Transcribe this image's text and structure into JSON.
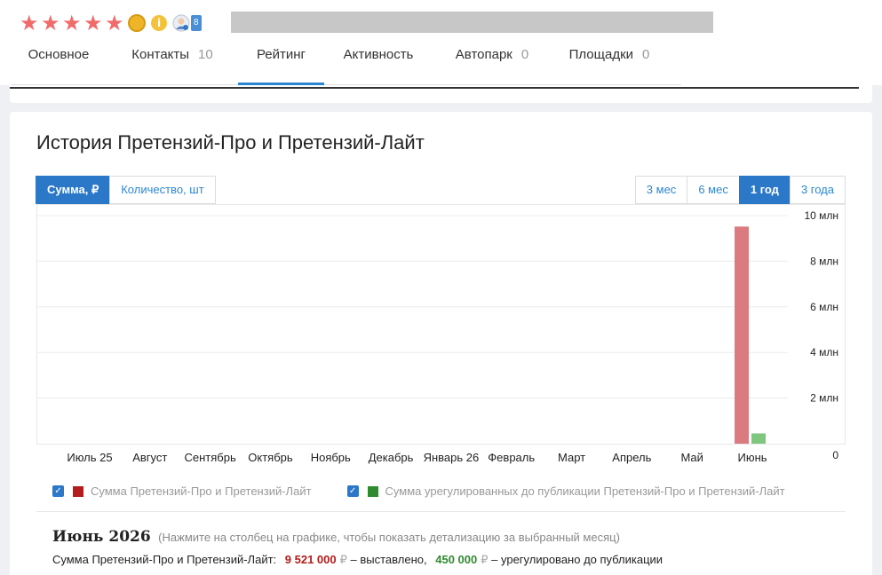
{
  "header": {
    "rating_stars": 5,
    "verified_count": "8",
    "info_badge": "i",
    "tabs": [
      {
        "label": "Основное",
        "count": ""
      },
      {
        "label": "Контакты",
        "count": "10"
      },
      {
        "label": "Рейтинг",
        "count": ""
      },
      {
        "label": "Активность",
        "count": ""
      },
      {
        "label": "Автопарк",
        "count": "0"
      },
      {
        "label": "Площадки",
        "count": "0"
      }
    ],
    "active_tab": "Рейтинг"
  },
  "card": {
    "title": "История Претензий-Про и Претензий-Лайт",
    "metric_buttons": [
      "Сумма, ₽",
      "Количество, шт"
    ],
    "active_metric": "Сумма, ₽",
    "period_buttons": [
      "3 мес",
      "6 мес",
      "1 год",
      "3 года"
    ],
    "active_period": "1 год"
  },
  "colors": {
    "accent": "#2b78c8",
    "star": "#f26b6b",
    "series_claims": "#db7b80",
    "series_settled": "#7fc67f",
    "legend_claims": "#b31d1d",
    "legend_settled": "#2e8b2e"
  },
  "chart_data": {
    "type": "bar",
    "categories": [
      "Июль 25",
      "Август",
      "Сентябрь",
      "Октябрь",
      "Ноябрь",
      "Декабрь",
      "Январь 26",
      "Февраль",
      "Март",
      "Апрель",
      "Май",
      "Июнь"
    ],
    "series": [
      {
        "name": "Сумма Претензий-Про и Претензий-Лайт",
        "values": [
          0,
          0,
          0,
          0,
          0,
          0,
          0,
          0,
          0,
          0,
          0,
          9521000
        ]
      },
      {
        "name": "Сумма урегулированных до публикации Претензий-Про и Претензий-Лайт",
        "values": [
          0,
          0,
          0,
          0,
          0,
          0,
          0,
          0,
          0,
          0,
          0,
          450000
        ]
      }
    ],
    "y_ticks": [
      {
        "value": 0,
        "label": "0"
      },
      {
        "value": 2000000,
        "label": "2 млн"
      },
      {
        "value": 4000000,
        "label": "4 млн"
      },
      {
        "value": 6000000,
        "label": "6 млн"
      },
      {
        "value": 8000000,
        "label": "8 млн"
      },
      {
        "value": 10000000,
        "label": "10 млн"
      }
    ],
    "ylim": [
      0,
      10000000
    ],
    "grid": true,
    "legend_position": "bottom"
  },
  "legend": {
    "items": [
      {
        "label": "Сумма Претензий-Про и Претензий-Лайт",
        "checked": true
      },
      {
        "label": "Сумма урегулированных до публикации Претензий-Про и Претензий-Лайт",
        "checked": true
      }
    ]
  },
  "detail": {
    "month": "Июнь 2026",
    "hint": "(Нажмите на столбец на графике, чтобы показать детализацию за выбранный месяц)",
    "label": "Сумма Претензий-Про и Претензий-Лайт:",
    "claimed_amount": "9 521 000",
    "currency": "₽",
    "claimed_suffix": "– выставлено,",
    "settled_amount": "450 000",
    "settled_suffix": "– урегулировано до публикации"
  }
}
